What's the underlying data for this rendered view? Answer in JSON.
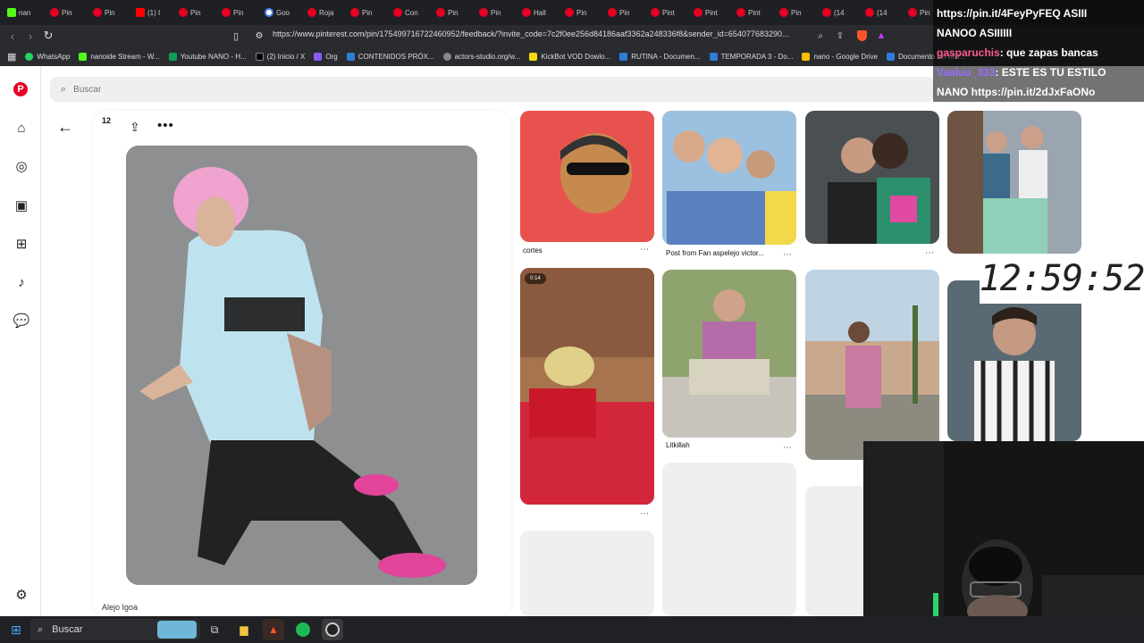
{
  "browser": {
    "tabs": [
      {
        "label": "nan",
        "icon": "kick"
      },
      {
        "label": "Pin",
        "icon": "pinterest"
      },
      {
        "label": "Pin",
        "icon": "pinterest"
      },
      {
        "label": "(1) I",
        "icon": "youtube"
      },
      {
        "label": "Pin",
        "icon": "pinterest"
      },
      {
        "label": "Pin",
        "icon": "pinterest"
      },
      {
        "label": "Goo",
        "icon": "google"
      },
      {
        "label": "Roja",
        "icon": "pinterest"
      },
      {
        "label": "Pin",
        "icon": "pinterest"
      },
      {
        "label": "Con",
        "icon": "pinterest"
      },
      {
        "label": "Pin",
        "icon": "pinterest"
      },
      {
        "label": "Pin",
        "icon": "pinterest"
      },
      {
        "label": "Hall",
        "icon": "pinterest"
      },
      {
        "label": "Pin",
        "icon": "pinterest"
      },
      {
        "label": "Pin",
        "icon": "pinterest"
      },
      {
        "label": "Pint",
        "icon": "pinterest"
      },
      {
        "label": "Pint",
        "icon": "pinterest"
      },
      {
        "label": "Pint",
        "icon": "pinterest"
      },
      {
        "label": "Pin",
        "icon": "pinterest"
      },
      {
        "label": "(14",
        "icon": "pinterest"
      },
      {
        "label": "(14",
        "icon": "pinterest"
      },
      {
        "label": "Pin",
        "icon": "pinterest"
      }
    ],
    "url": "https://www.pinterest.com/pin/175499716722460952/feedback/?invite_code=7c2f0ee256d84186aaf3362a248336f8&sender_id=654077683290...",
    "bookmarks": [
      "WhatsApp",
      "nanoide Stream - W...",
      "Youtube NANO - H...",
      "(2) Inicio / X",
      "Org",
      "CONTENIDOS PRÓX...",
      "actors-studio.org/w...",
      "KickBot VOD Dowlo...",
      "RUTINA - Documen...",
      "TEMPORADA 3 - Do...",
      "nano - Google Drive",
      "Documento sin títul..."
    ]
  },
  "pinterest": {
    "search_placeholder": "Buscar",
    "pin_count": "12",
    "author": "Alejo Igoa",
    "grid_titles": {
      "p1": "cortes",
      "p2": "Post from Fan aspelejo victor...",
      "p6": "Litkillah"
    },
    "video_badge": "0:14"
  },
  "stream_overlay": {
    "line1": "https://pin.it/4FeyPyFEQ ASIII",
    "line2": "NANOO ASIIIIII",
    "user1": "gasparuchis",
    "msg1": ": que zapas bancas",
    "user2": "Vaaluu_333",
    "msg2": ": ESTE ES TU ESTILO",
    "line5": "NANO https://pin.it/2dJxFaONo"
  },
  "clock": "12:59:52",
  "taskbar": {
    "search_label": "Buscar"
  },
  "colors": {
    "pinterest_red": "#e60023",
    "chrome_dark": "#1f2023"
  }
}
